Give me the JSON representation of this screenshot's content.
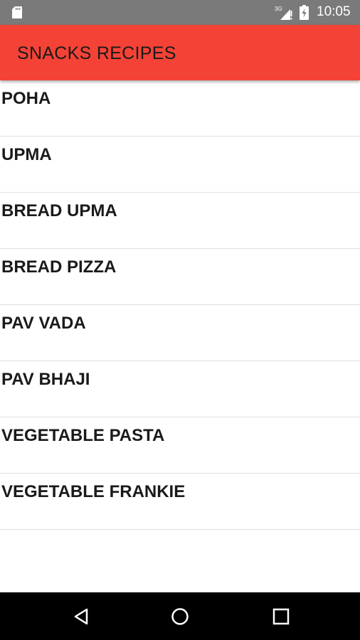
{
  "status_bar": {
    "network_label": "3G",
    "time": "10:05",
    "icons": [
      "sd-card-icon",
      "signal-icon",
      "battery-charging-icon"
    ]
  },
  "app_bar": {
    "title": "SNACKS RECIPES",
    "color": "#f44336"
  },
  "recipes": [
    {
      "label": "POHA"
    },
    {
      "label": "UPMA"
    },
    {
      "label": "BREAD UPMA"
    },
    {
      "label": "BREAD PIZZA"
    },
    {
      "label": "PAV VADA"
    },
    {
      "label": "PAV BHAJI"
    },
    {
      "label": "VEGETABLE PASTA"
    },
    {
      "label": "VEGETABLE FRANKIE"
    }
  ],
  "nav_bar": {
    "icons": [
      "back-icon",
      "home-icon",
      "recents-icon"
    ]
  }
}
